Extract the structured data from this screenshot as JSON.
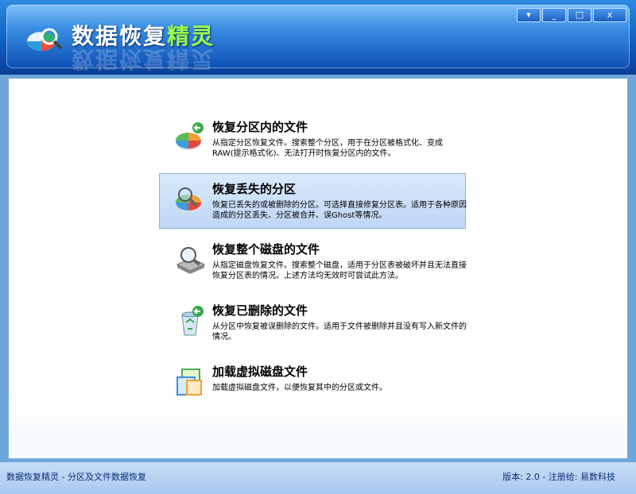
{
  "window": {
    "title_main": "数据恢复",
    "title_accent": "精灵",
    "controls": {
      "menu": "▾",
      "minimize": "_",
      "maximize": "□",
      "close": "x"
    }
  },
  "menu": {
    "items": [
      {
        "title": "恢复分区内的文件",
        "desc": "从指定分区恢复文件。搜索整个分区，用于在分区被格式化、变成RAW(提示格式化)、无法打开时恢复分区内的文件。",
        "icon": "partition-pie-icon"
      },
      {
        "title": "恢复丢失的分区",
        "desc": "恢复已丢失的或被删除的分区。可选择直接修复分区表。适用于各种原因造成的分区丢失、分区被合并、误Ghost等情况。",
        "icon": "search-pie-icon"
      },
      {
        "title": "恢复整个磁盘的文件",
        "desc": "从指定磁盘恢复文件。搜索整个磁盘，适用于分区表被破坏并且无法直接恢复分区表的情况。上述方法均无效时可尝试此方法。",
        "icon": "disk-search-icon"
      },
      {
        "title": "恢复已删除的文件",
        "desc": "从分区中恢复被误删除的文件。适用于文件被删除并且没有写入新文件的情况。",
        "icon": "recycle-bin-icon"
      },
      {
        "title": "加载虚拟磁盘文件",
        "desc": "加载虚拟磁盘文件，以便恢复其中的分区或文件。",
        "icon": "virtual-disk-icon"
      }
    ],
    "selected_index": 1
  },
  "status": {
    "left": "数据恢复精灵 - 分区及文件数据恢复",
    "right": "版本: 2.0 - 注册给: 易数科技"
  }
}
